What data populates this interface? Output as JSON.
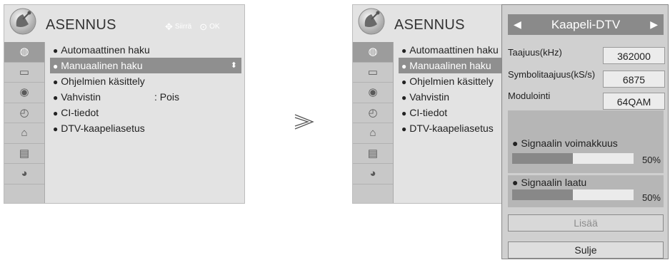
{
  "colors": {
    "menu_bg": "#e3e3e3",
    "iconbar_bg": "#c8c8c8",
    "selected_item": "#8f8f8f",
    "popup_bg": "#d0d0d0",
    "popup_header": "#8a8a8a"
  },
  "left_menu": {
    "title": "ASENNUS",
    "nav_hint": {
      "move_label": "Siirrä",
      "ok_label": "OK"
    },
    "icons": [
      "satellite-icon",
      "monitor-icon",
      "speaker-icon",
      "clock-icon",
      "lock-icon",
      "briefcase-icon",
      "network-icon"
    ],
    "items": [
      {
        "label": "Automaattinen haku",
        "value": ""
      },
      {
        "label": "Manuaalinen haku",
        "value": ""
      },
      {
        "label": "Ohjelmien käsittely",
        "value": ""
      },
      {
        "label": "Vahvistin",
        "value": ": Pois"
      },
      {
        "label": "CI-tiedot",
        "value": ""
      },
      {
        "label": "DTV-kaapeliasetus",
        "value": ""
      }
    ],
    "selected_index": 1
  },
  "right_menu": {
    "title": "ASENNUS",
    "items": [
      {
        "label": "Automaattinen haku"
      },
      {
        "label": "Manuaalinen haku"
      },
      {
        "label": "Ohjelmien käsittely"
      },
      {
        "label": "Vahvistin"
      },
      {
        "label": "CI-tiedot"
      },
      {
        "label": "DTV-kaapeliasetus"
      }
    ],
    "selected_index": 1
  },
  "popup": {
    "header": "Kaapeli-DTV",
    "fields": [
      {
        "label": "Taajuus(kHz)",
        "value": "362000"
      },
      {
        "label": "Symbolitaajuus(kS/s)",
        "value": "6875"
      },
      {
        "label": "Modulointi",
        "value": "64QAM"
      }
    ],
    "signal_strength": {
      "label": "Signaalin voimakkuus",
      "percent_text": "50%",
      "fraction": 0.5
    },
    "signal_quality": {
      "label": "Signaalin laatu",
      "percent_text": "50%",
      "fraction": 0.5
    },
    "buttons": {
      "more": "Lisää",
      "close": "Sulje"
    }
  }
}
